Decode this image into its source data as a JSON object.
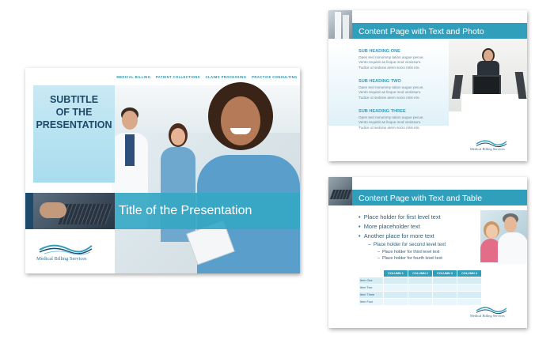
{
  "main_slide": {
    "nav": [
      "MEDICAL BILLING",
      "PATIENT COLLECTIONS",
      "CLAIMS PROCESSING",
      "PRACTICE CONSULTING"
    ],
    "subtitle_lines": [
      "SUBTITLE",
      "OF THE",
      "PRESENTATION"
    ],
    "title": "Title of the Presentation",
    "logo_text": "Medical Billing Services"
  },
  "photo_slide": {
    "title": "Content Page with Text and Photo",
    "sections": [
      {
        "heading": "SUB HEADING ONE",
        "lines": [
          "Opes sed nonummy tation  augue pecue.",
          "Vento requisit as lisque  mod venissum.",
          "Tudice ut sedone arem  socio rotis eto."
        ]
      },
      {
        "heading": "SUB HEADING TWO",
        "lines": [
          "Opes sed nonummy tation  augue pecue.",
          "Vento requisit as lisque  mod venissum.",
          "Tudice ut sedone arem  socio rotis eto."
        ]
      },
      {
        "heading": "SUB HEADING THREE",
        "lines": [
          "Opes sed nonummy tation  augue pecue.",
          "Vento requisit as lisque  mod venissum.",
          "Tudice ut sedone arem  socio rotis eto."
        ]
      }
    ],
    "logo_text": "Medical Billing Services"
  },
  "table_slide": {
    "title": "Content Page with Text and Table",
    "bullets_level1": [
      "Place holder for first level text",
      "More placeholder text",
      "Another place for more text"
    ],
    "bullet_level2": "Place holder for second level text",
    "bullet_level3": [
      "Place holder for third level text",
      "Place holder for fourth level text"
    ],
    "columns": [
      "COLUMN 1",
      "COLUMN 2",
      "COLUMN 3",
      "COLUMN 4"
    ],
    "rows": [
      "Item One",
      "Item Two",
      "Item Three",
      "Item Four"
    ],
    "logo_text": "Medical Billing Services"
  },
  "colors": {
    "accent": "#2f9fbc",
    "navy": "#1d4a6b",
    "light": "#c9e9f4"
  }
}
